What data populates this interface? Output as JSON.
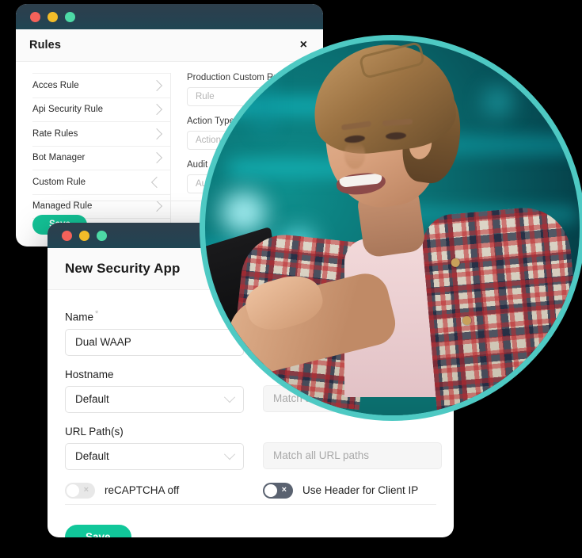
{
  "rules_window": {
    "traffic_lights": [
      "close-red",
      "minimize-yellow",
      "maximize-green"
    ],
    "title": "Rules",
    "close_label": "×",
    "rules_list": [
      {
        "label": "Acces Rule",
        "chevron": "chevron-right",
        "selected": false
      },
      {
        "label": "Api Security Rule",
        "chevron": "chevron-right",
        "selected": false
      },
      {
        "label": "Rate Rules",
        "chevron": "chevron-right",
        "selected": false
      },
      {
        "label": "Bot Manager",
        "chevron": "chevron-right",
        "selected": false
      },
      {
        "label": "Custom Rule",
        "chevron": "chevron-left",
        "selected": true
      },
      {
        "label": "Managed Rule",
        "chevron": "chevron-right",
        "selected": false
      }
    ],
    "detail_fields": [
      {
        "label": "Production Custom Rule",
        "placeholder": "Rule"
      },
      {
        "label": "Action Type",
        "placeholder": "Action"
      },
      {
        "label": "Audit",
        "placeholder": "Audit"
      }
    ],
    "save_label": "Save"
  },
  "app_window": {
    "traffic_lights": [
      "close-red",
      "minimize-yellow",
      "maximize-green"
    ],
    "title": "New Security App",
    "name_field": {
      "label": "Name",
      "required_marker": "*",
      "value": "Dual WAAP"
    },
    "hostname_field": {
      "label": "Hostname",
      "selected": "Default",
      "match_placeholder": "Match all hostnames"
    },
    "url_path_field": {
      "label": "URL Path(s)",
      "selected": "Default",
      "match_placeholder": "Match all URL paths"
    },
    "recaptcha_toggle": {
      "label": "reCAPTCHA off",
      "state": "off",
      "glyph": "×"
    },
    "client_ip_toggle": {
      "label": "Use Header for Client IP",
      "state": "off",
      "glyph": "×"
    },
    "save_label": "Save"
  },
  "photo": {
    "alt": "smiling person with short blonde hair in plaid shirt typing on a laptop, teal bokeh background",
    "ring_color": "#4ec9c3"
  },
  "colors": {
    "titlebar_start": "#2d3f4c",
    "titlebar_end": "#1f4653",
    "save_green": "#11c79a",
    "teal_ring": "#4ec9c3",
    "dot_red": "#f4625a",
    "dot_yellow": "#f2bc29",
    "dot_green": "#4ddaa6",
    "background": "#000000"
  }
}
